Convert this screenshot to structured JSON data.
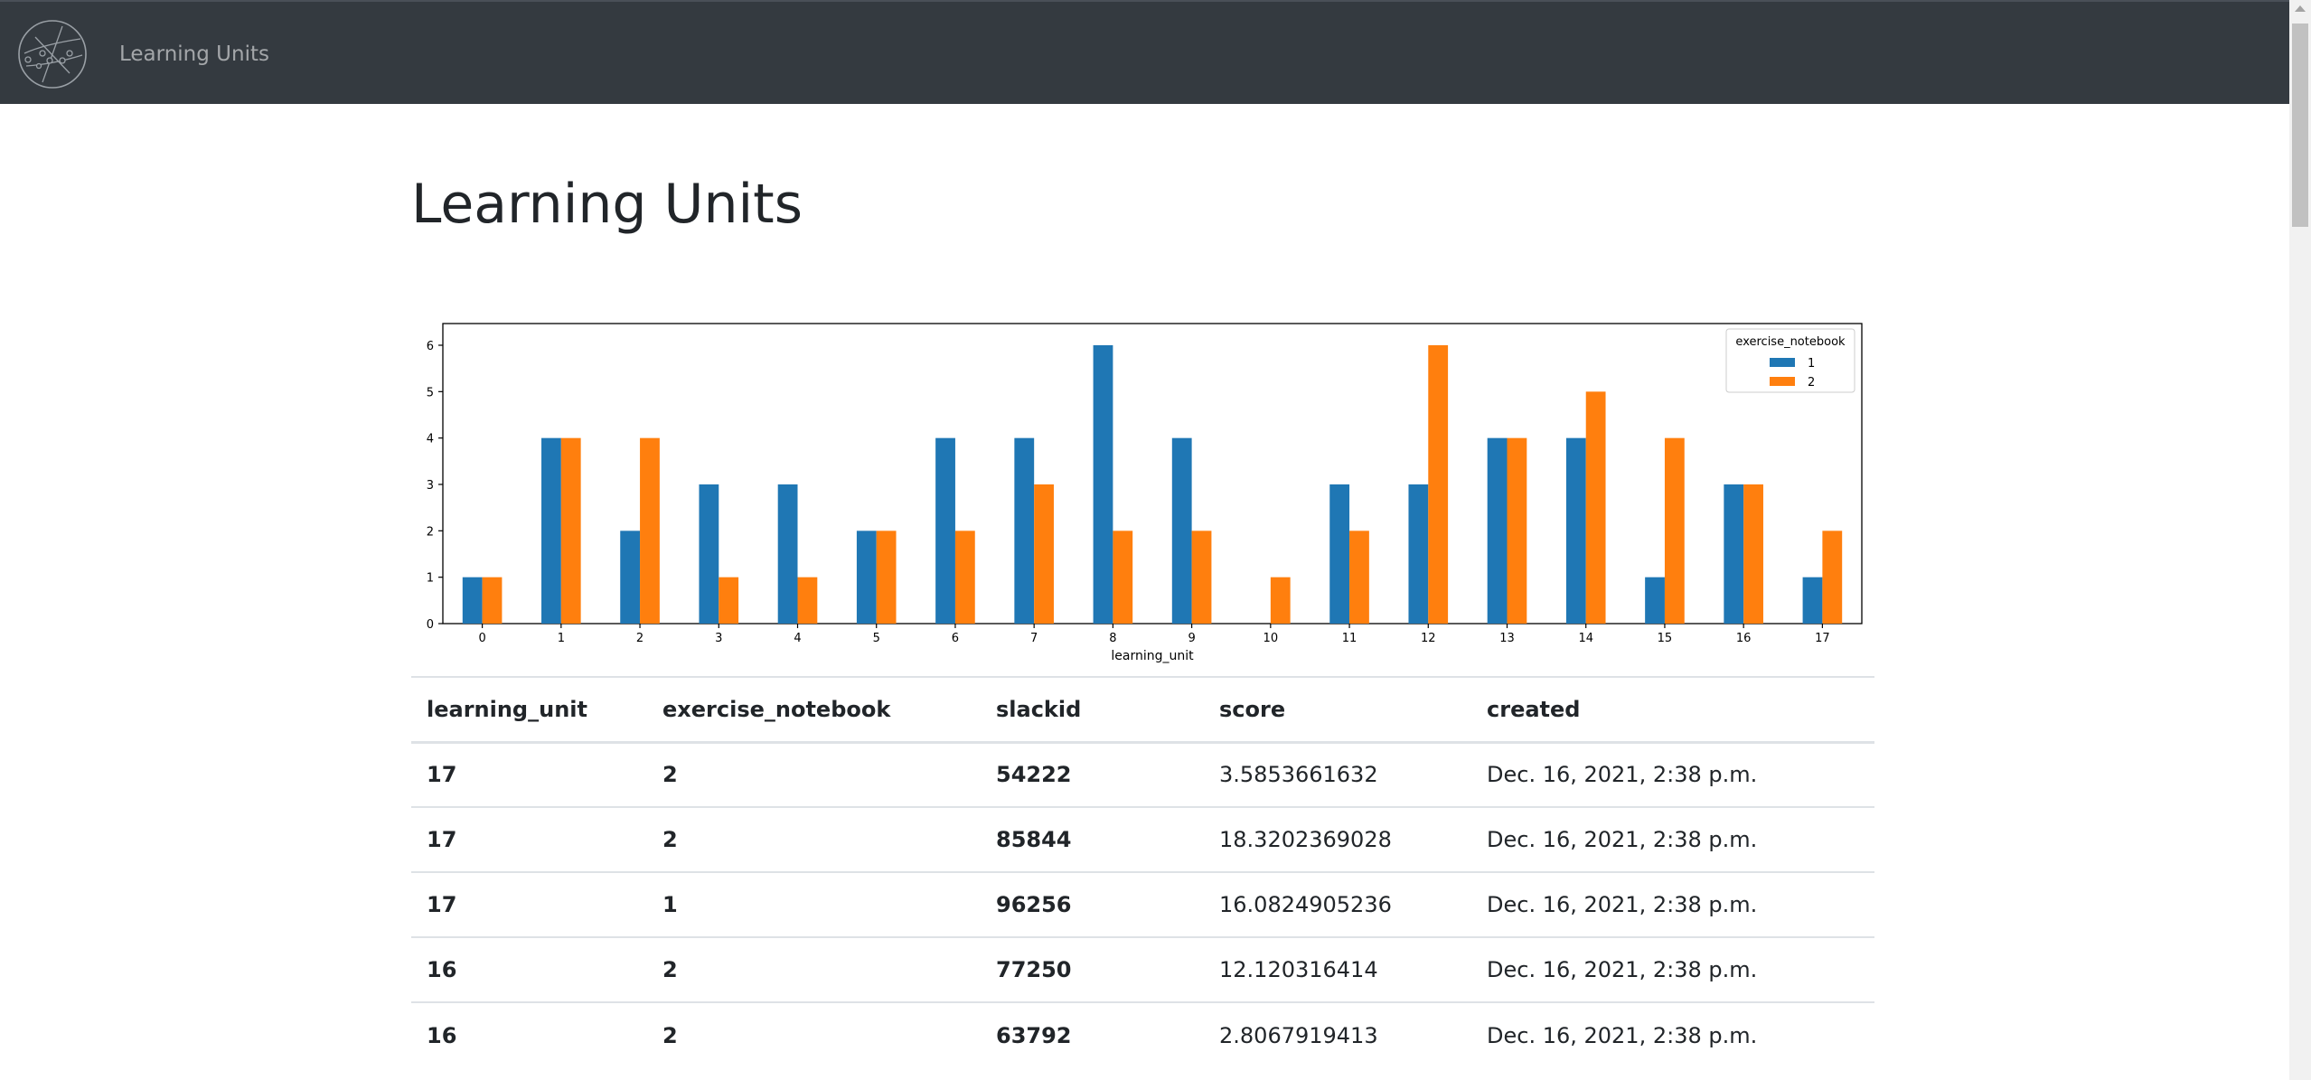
{
  "navbar": {
    "brand": "Learning Units",
    "logo_icon": "constellation-globe-logo"
  },
  "page": {
    "title": "Learning Units"
  },
  "chart_data": {
    "type": "bar",
    "categories": [
      "0",
      "1",
      "2",
      "3",
      "4",
      "5",
      "6",
      "7",
      "8",
      "9",
      "10",
      "11",
      "12",
      "13",
      "14",
      "15",
      "16",
      "17"
    ],
    "series": [
      {
        "name": "1",
        "color": "#1f77b4",
        "values": [
          1,
          4,
          2,
          3,
          3,
          2,
          4,
          4,
          6,
          4,
          0,
          3,
          3,
          4,
          4,
          1,
          3,
          1
        ]
      },
      {
        "name": "2",
        "color": "#ff7f0e",
        "values": [
          1,
          4,
          4,
          1,
          1,
          2,
          2,
          3,
          2,
          2,
          1,
          2,
          6,
          4,
          5,
          4,
          3,
          2
        ]
      }
    ],
    "xlabel": "learning_unit",
    "ylabel": "",
    "yticks": [
      "0",
      "1",
      "2",
      "3",
      "4",
      "5",
      "6"
    ],
    "ylim": [
      0,
      6
    ],
    "legend_title": "exercise_notebook",
    "legend_position": "top-right",
    "grid": false
  },
  "table": {
    "headers": [
      "learning_unit",
      "exercise_notebook",
      "slackid",
      "score",
      "created"
    ],
    "rows": [
      [
        "17",
        "2",
        "54222",
        "3.5853661632",
        "Dec. 16, 2021, 2:38 p.m."
      ],
      [
        "17",
        "2",
        "85844",
        "18.3202369028",
        "Dec. 16, 2021, 2:38 p.m."
      ],
      [
        "17",
        "1",
        "96256",
        "16.0824905236",
        "Dec. 16, 2021, 2:38 p.m."
      ],
      [
        "16",
        "2",
        "77250",
        "12.120316414",
        "Dec. 16, 2021, 2:38 p.m."
      ],
      [
        "16",
        "2",
        "63792",
        "2.8067919413",
        "Dec. 16, 2021, 2:38 p.m."
      ]
    ]
  }
}
